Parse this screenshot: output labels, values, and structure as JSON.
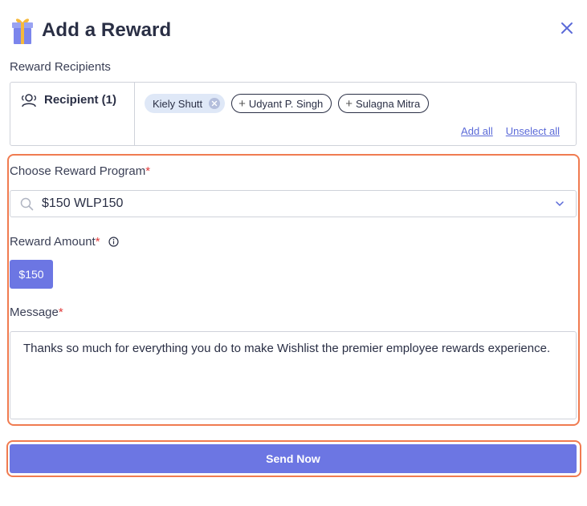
{
  "header": {
    "title": "Add a Reward",
    "icon": "gift-icon",
    "close_icon": "close-icon"
  },
  "recipients": {
    "label": "Reward Recipients",
    "count_label": "Recipient (1)",
    "selected": [
      {
        "name": "Kiely Shutt"
      }
    ],
    "options": [
      {
        "name": "Udyant P. Singh"
      },
      {
        "name": "Sulagna Mitra"
      }
    ],
    "add_all": "Add all",
    "unselect_all": "Unselect all"
  },
  "program": {
    "label": "Choose Reward Program",
    "required_mark": "*",
    "value": "$150 WLP150"
  },
  "amount": {
    "label": "Reward Amount",
    "required_mark": "*",
    "value": "$150"
  },
  "message": {
    "label": "Message",
    "required_mark": "*",
    "value": "Thanks so much for everything you do to make Wishlist the premier employee rewards experience."
  },
  "actions": {
    "send_label": "Send Now"
  },
  "colors": {
    "accent": "#6c76e3",
    "highlight": "#f07b50",
    "required": "#e03a3a",
    "link": "#5b6ad8"
  }
}
